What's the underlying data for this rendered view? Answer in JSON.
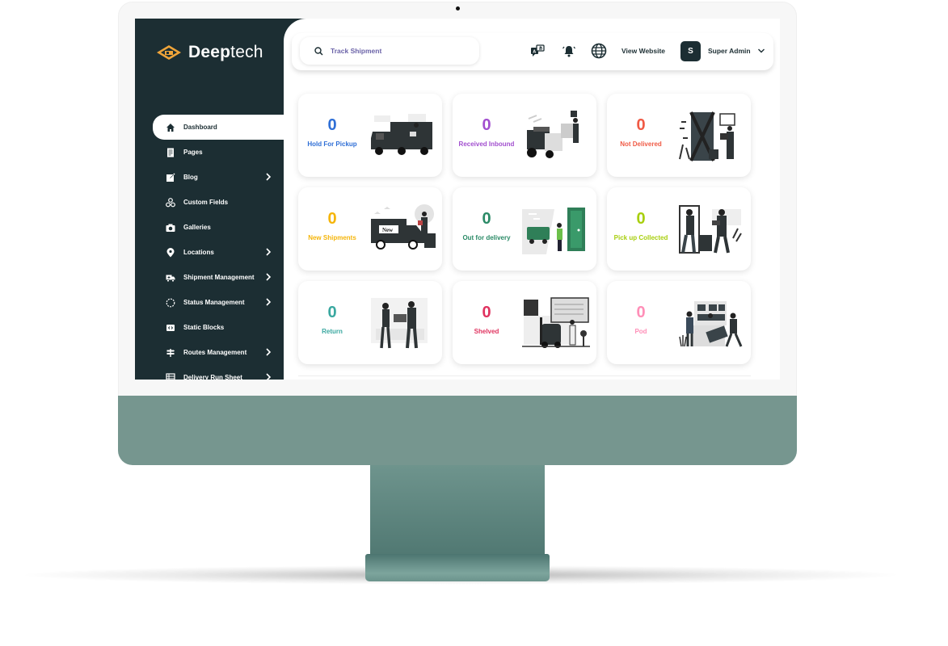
{
  "brand": {
    "name_bold": "Deep",
    "name_light": "tech",
    "accent": "#f0a53a"
  },
  "sidebar": {
    "items": [
      {
        "label": "Dashboard",
        "icon": "home-icon",
        "active": true,
        "has_submenu": false
      },
      {
        "label": "Pages",
        "icon": "page-icon",
        "active": false,
        "has_submenu": false
      },
      {
        "label": "Blog",
        "icon": "edit-icon",
        "active": false,
        "has_submenu": true
      },
      {
        "label": "Custom Fields",
        "icon": "cubes-icon",
        "active": false,
        "has_submenu": false
      },
      {
        "label": "Galleries",
        "icon": "camera-icon",
        "active": false,
        "has_submenu": false
      },
      {
        "label": "Locations",
        "icon": "map-pin-icon",
        "active": false,
        "has_submenu": true
      },
      {
        "label": "Shipment Management",
        "icon": "truck-icon",
        "active": false,
        "has_submenu": true
      },
      {
        "label": "Status Management",
        "icon": "spinner-icon",
        "active": false,
        "has_submenu": true
      },
      {
        "label": "Static Blocks",
        "icon": "code-icon",
        "active": false,
        "has_submenu": false
      },
      {
        "label": "Routes Management",
        "icon": "signpost-icon",
        "active": false,
        "has_submenu": true
      },
      {
        "label": "Delivery Run Sheet",
        "icon": "table-icon",
        "active": false,
        "has_submenu": true
      }
    ]
  },
  "topbar": {
    "search_placeholder": "Track Shipment",
    "search_value": "",
    "icons": [
      "translate-icon",
      "bell-icon",
      "globe-icon"
    ],
    "view_website_label": "View Website",
    "user_initial": "S",
    "user_name": "Super Admin"
  },
  "cards": [
    {
      "count": "0",
      "label": "Hold For Pickup",
      "color": "#2f6fd6",
      "illustration": "delivery-truck-illustration"
    },
    {
      "count": "0",
      "label": "Received Inbound",
      "color": "#a24fcf",
      "illustration": "forklift-inbound-illustration"
    },
    {
      "count": "0",
      "label": "Not Delivered",
      "color": "#f05a45",
      "illustration": "blocked-door-illustration"
    },
    {
      "count": "0",
      "label": "New Shipments",
      "color": "#f5b50a",
      "illustration": "new-truck-illustration"
    },
    {
      "count": "0",
      "label": "Out for delivery",
      "color": "#2a8a66",
      "illustration": "van-door-illustration"
    },
    {
      "count": "0",
      "label": "Pick up Collected",
      "color": "#a8cf0e",
      "illustration": "pickup-handover-illustration"
    },
    {
      "count": "0",
      "label": "Return",
      "color": "#3aa8a0",
      "illustration": "return-handover-illustration"
    },
    {
      "count": "0",
      "label": "Shelved",
      "color": "#e0325f",
      "illustration": "warehouse-forklift-illustration"
    },
    {
      "count": "0",
      "label": "Pod",
      "color": "#ff8fb8",
      "illustration": "store-counter-illustration"
    }
  ]
}
